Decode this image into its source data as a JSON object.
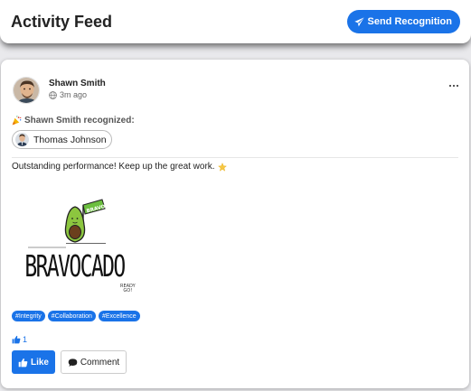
{
  "header": {
    "title": "Activity Feed",
    "send_button_label": "Send Recognition"
  },
  "post": {
    "author_name": "Shawn Smith",
    "timestamp": "3m ago",
    "recognized_line": "Shawn Smith recognized:",
    "recipient_name": "Thomas Johnson",
    "message": "Outstanding performance! Keep up the great work.",
    "image": {
      "flag_text": "BRAVO",
      "word": "BRAVOCADO",
      "footer_text_line1": "READY",
      "footer_text_line2": "GO!"
    },
    "tags": [
      "#Integrity",
      "#Collaboration",
      "#Excellence"
    ],
    "like_count": "1",
    "like_button_label": "Like",
    "comment_button_label": "Comment"
  },
  "icons": {
    "send": "paper-plane-icon",
    "globe": "globe-icon",
    "more": "more-horizontal-icon",
    "celebrate": "party-popper-icon",
    "star": "star-icon",
    "thumbs_up": "thumbs-up-icon",
    "comment": "speech-bubble-icon"
  },
  "colors": {
    "accent": "#1a73e8",
    "background": "#e9e9ec",
    "card": "#ffffff",
    "avocado_green": "#8cc63f",
    "avocado_pit": "#6b3f1d"
  }
}
